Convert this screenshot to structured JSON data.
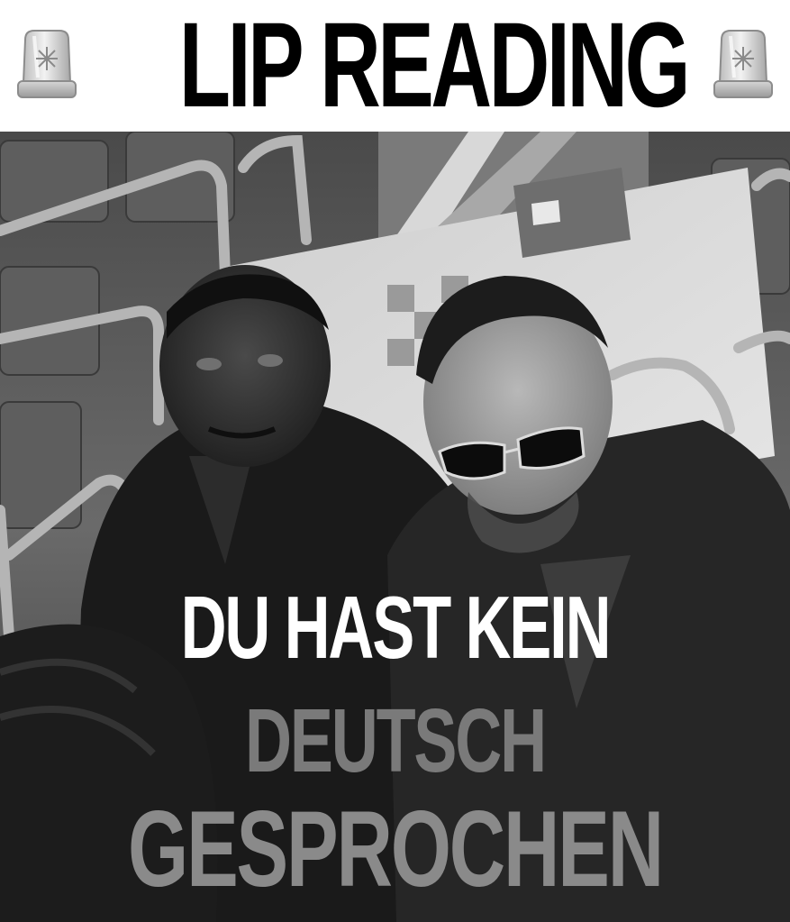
{
  "header": {
    "title": "LIP READING",
    "left_icon": "siren-light-icon",
    "right_icon": "siren-light-icon"
  },
  "photo": {
    "subject": "two-men-seated-in-stadium-stands"
  },
  "caption": {
    "line1": "DU HAST KEIN",
    "line2": "DEUTSCH",
    "line3": "GESPROCHEN"
  },
  "colors": {
    "background": "#ffffff",
    "title": "#000000",
    "caption_primary": "#ffffff",
    "caption_secondary": "#7a7a7a"
  }
}
